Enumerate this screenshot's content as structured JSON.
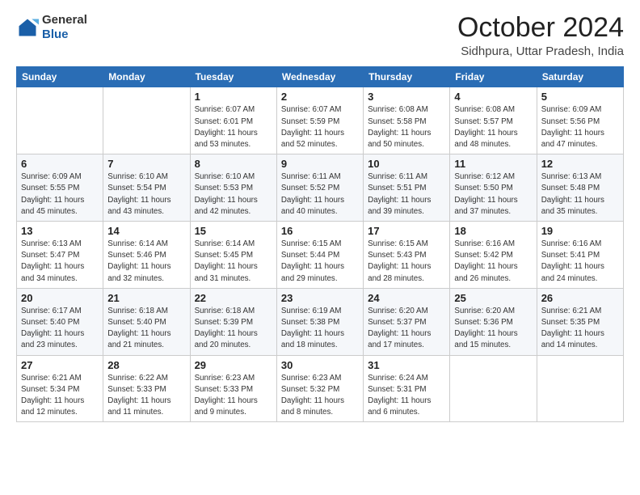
{
  "logo": {
    "line1": "General",
    "line2": "Blue"
  },
  "header": {
    "month": "October 2024",
    "location": "Sidhpura, Uttar Pradesh, India"
  },
  "weekdays": [
    "Sunday",
    "Monday",
    "Tuesday",
    "Wednesday",
    "Thursday",
    "Friday",
    "Saturday"
  ],
  "weeks": [
    [
      {
        "day": "",
        "sunrise": "",
        "sunset": "",
        "daylight": ""
      },
      {
        "day": "",
        "sunrise": "",
        "sunset": "",
        "daylight": ""
      },
      {
        "day": "1",
        "sunrise": "Sunrise: 6:07 AM",
        "sunset": "Sunset: 6:01 PM",
        "daylight": "Daylight: 11 hours and 53 minutes."
      },
      {
        "day": "2",
        "sunrise": "Sunrise: 6:07 AM",
        "sunset": "Sunset: 5:59 PM",
        "daylight": "Daylight: 11 hours and 52 minutes."
      },
      {
        "day": "3",
        "sunrise": "Sunrise: 6:08 AM",
        "sunset": "Sunset: 5:58 PM",
        "daylight": "Daylight: 11 hours and 50 minutes."
      },
      {
        "day": "4",
        "sunrise": "Sunrise: 6:08 AM",
        "sunset": "Sunset: 5:57 PM",
        "daylight": "Daylight: 11 hours and 48 minutes."
      },
      {
        "day": "5",
        "sunrise": "Sunrise: 6:09 AM",
        "sunset": "Sunset: 5:56 PM",
        "daylight": "Daylight: 11 hours and 47 minutes."
      }
    ],
    [
      {
        "day": "6",
        "sunrise": "Sunrise: 6:09 AM",
        "sunset": "Sunset: 5:55 PM",
        "daylight": "Daylight: 11 hours and 45 minutes."
      },
      {
        "day": "7",
        "sunrise": "Sunrise: 6:10 AM",
        "sunset": "Sunset: 5:54 PM",
        "daylight": "Daylight: 11 hours and 43 minutes."
      },
      {
        "day": "8",
        "sunrise": "Sunrise: 6:10 AM",
        "sunset": "Sunset: 5:53 PM",
        "daylight": "Daylight: 11 hours and 42 minutes."
      },
      {
        "day": "9",
        "sunrise": "Sunrise: 6:11 AM",
        "sunset": "Sunset: 5:52 PM",
        "daylight": "Daylight: 11 hours and 40 minutes."
      },
      {
        "day": "10",
        "sunrise": "Sunrise: 6:11 AM",
        "sunset": "Sunset: 5:51 PM",
        "daylight": "Daylight: 11 hours and 39 minutes."
      },
      {
        "day": "11",
        "sunrise": "Sunrise: 6:12 AM",
        "sunset": "Sunset: 5:50 PM",
        "daylight": "Daylight: 11 hours and 37 minutes."
      },
      {
        "day": "12",
        "sunrise": "Sunrise: 6:13 AM",
        "sunset": "Sunset: 5:48 PM",
        "daylight": "Daylight: 11 hours and 35 minutes."
      }
    ],
    [
      {
        "day": "13",
        "sunrise": "Sunrise: 6:13 AM",
        "sunset": "Sunset: 5:47 PM",
        "daylight": "Daylight: 11 hours and 34 minutes."
      },
      {
        "day": "14",
        "sunrise": "Sunrise: 6:14 AM",
        "sunset": "Sunset: 5:46 PM",
        "daylight": "Daylight: 11 hours and 32 minutes."
      },
      {
        "day": "15",
        "sunrise": "Sunrise: 6:14 AM",
        "sunset": "Sunset: 5:45 PM",
        "daylight": "Daylight: 11 hours and 31 minutes."
      },
      {
        "day": "16",
        "sunrise": "Sunrise: 6:15 AM",
        "sunset": "Sunset: 5:44 PM",
        "daylight": "Daylight: 11 hours and 29 minutes."
      },
      {
        "day": "17",
        "sunrise": "Sunrise: 6:15 AM",
        "sunset": "Sunset: 5:43 PM",
        "daylight": "Daylight: 11 hours and 28 minutes."
      },
      {
        "day": "18",
        "sunrise": "Sunrise: 6:16 AM",
        "sunset": "Sunset: 5:42 PM",
        "daylight": "Daylight: 11 hours and 26 minutes."
      },
      {
        "day": "19",
        "sunrise": "Sunrise: 6:16 AM",
        "sunset": "Sunset: 5:41 PM",
        "daylight": "Daylight: 11 hours and 24 minutes."
      }
    ],
    [
      {
        "day": "20",
        "sunrise": "Sunrise: 6:17 AM",
        "sunset": "Sunset: 5:40 PM",
        "daylight": "Daylight: 11 hours and 23 minutes."
      },
      {
        "day": "21",
        "sunrise": "Sunrise: 6:18 AM",
        "sunset": "Sunset: 5:40 PM",
        "daylight": "Daylight: 11 hours and 21 minutes."
      },
      {
        "day": "22",
        "sunrise": "Sunrise: 6:18 AM",
        "sunset": "Sunset: 5:39 PM",
        "daylight": "Daylight: 11 hours and 20 minutes."
      },
      {
        "day": "23",
        "sunrise": "Sunrise: 6:19 AM",
        "sunset": "Sunset: 5:38 PM",
        "daylight": "Daylight: 11 hours and 18 minutes."
      },
      {
        "day": "24",
        "sunrise": "Sunrise: 6:20 AM",
        "sunset": "Sunset: 5:37 PM",
        "daylight": "Daylight: 11 hours and 17 minutes."
      },
      {
        "day": "25",
        "sunrise": "Sunrise: 6:20 AM",
        "sunset": "Sunset: 5:36 PM",
        "daylight": "Daylight: 11 hours and 15 minutes."
      },
      {
        "day": "26",
        "sunrise": "Sunrise: 6:21 AM",
        "sunset": "Sunset: 5:35 PM",
        "daylight": "Daylight: 11 hours and 14 minutes."
      }
    ],
    [
      {
        "day": "27",
        "sunrise": "Sunrise: 6:21 AM",
        "sunset": "Sunset: 5:34 PM",
        "daylight": "Daylight: 11 hours and 12 minutes."
      },
      {
        "day": "28",
        "sunrise": "Sunrise: 6:22 AM",
        "sunset": "Sunset: 5:33 PM",
        "daylight": "Daylight: 11 hours and 11 minutes."
      },
      {
        "day": "29",
        "sunrise": "Sunrise: 6:23 AM",
        "sunset": "Sunset: 5:33 PM",
        "daylight": "Daylight: 11 hours and 9 minutes."
      },
      {
        "day": "30",
        "sunrise": "Sunrise: 6:23 AM",
        "sunset": "Sunset: 5:32 PM",
        "daylight": "Daylight: 11 hours and 8 minutes."
      },
      {
        "day": "31",
        "sunrise": "Sunrise: 6:24 AM",
        "sunset": "Sunset: 5:31 PM",
        "daylight": "Daylight: 11 hours and 6 minutes."
      },
      {
        "day": "",
        "sunrise": "",
        "sunset": "",
        "daylight": ""
      },
      {
        "day": "",
        "sunrise": "",
        "sunset": "",
        "daylight": ""
      }
    ]
  ]
}
